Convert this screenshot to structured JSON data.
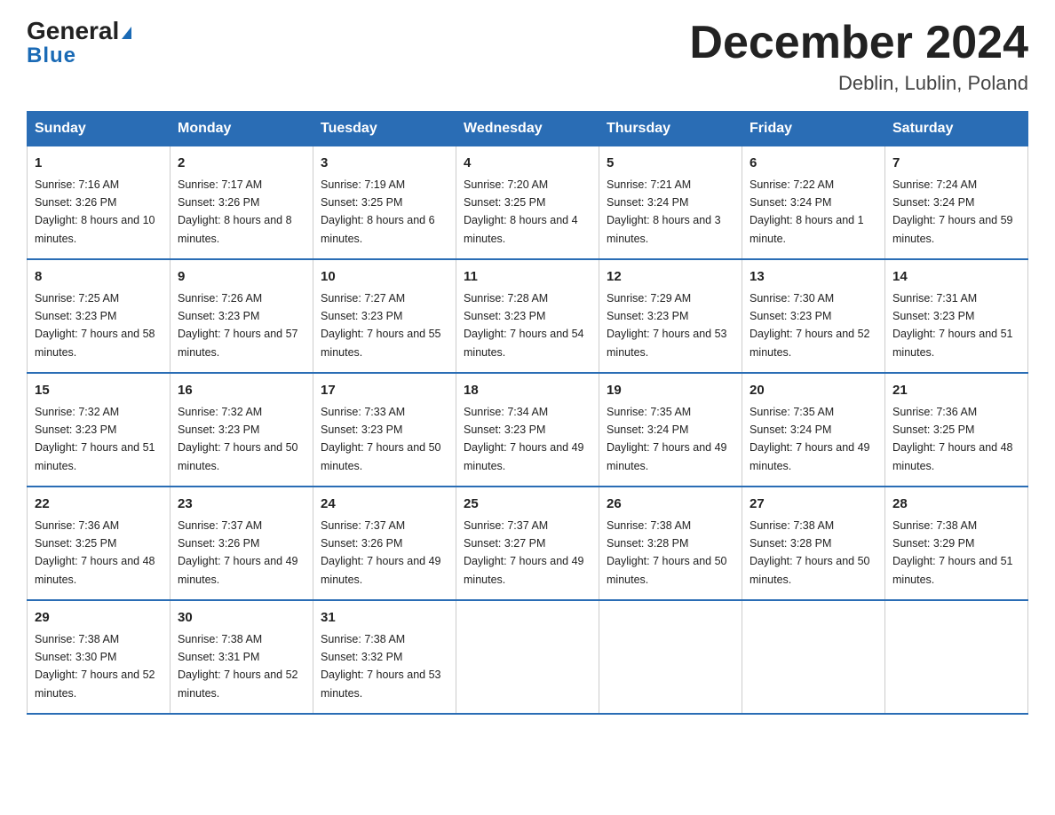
{
  "header": {
    "logo_general": "General",
    "logo_blue": "Blue",
    "title": "December 2024",
    "subtitle": "Deblin, Lublin, Poland"
  },
  "days_of_week": [
    "Sunday",
    "Monday",
    "Tuesday",
    "Wednesday",
    "Thursday",
    "Friday",
    "Saturday"
  ],
  "weeks": [
    [
      {
        "day": "1",
        "sunrise": "7:16 AM",
        "sunset": "3:26 PM",
        "daylight": "8 hours and 10 minutes."
      },
      {
        "day": "2",
        "sunrise": "7:17 AM",
        "sunset": "3:26 PM",
        "daylight": "8 hours and 8 minutes."
      },
      {
        "day": "3",
        "sunrise": "7:19 AM",
        "sunset": "3:25 PM",
        "daylight": "8 hours and 6 minutes."
      },
      {
        "day": "4",
        "sunrise": "7:20 AM",
        "sunset": "3:25 PM",
        "daylight": "8 hours and 4 minutes."
      },
      {
        "day": "5",
        "sunrise": "7:21 AM",
        "sunset": "3:24 PM",
        "daylight": "8 hours and 3 minutes."
      },
      {
        "day": "6",
        "sunrise": "7:22 AM",
        "sunset": "3:24 PM",
        "daylight": "8 hours and 1 minute."
      },
      {
        "day": "7",
        "sunrise": "7:24 AM",
        "sunset": "3:24 PM",
        "daylight": "7 hours and 59 minutes."
      }
    ],
    [
      {
        "day": "8",
        "sunrise": "7:25 AM",
        "sunset": "3:23 PM",
        "daylight": "7 hours and 58 minutes."
      },
      {
        "day": "9",
        "sunrise": "7:26 AM",
        "sunset": "3:23 PM",
        "daylight": "7 hours and 57 minutes."
      },
      {
        "day": "10",
        "sunrise": "7:27 AM",
        "sunset": "3:23 PM",
        "daylight": "7 hours and 55 minutes."
      },
      {
        "day": "11",
        "sunrise": "7:28 AM",
        "sunset": "3:23 PM",
        "daylight": "7 hours and 54 minutes."
      },
      {
        "day": "12",
        "sunrise": "7:29 AM",
        "sunset": "3:23 PM",
        "daylight": "7 hours and 53 minutes."
      },
      {
        "day": "13",
        "sunrise": "7:30 AM",
        "sunset": "3:23 PM",
        "daylight": "7 hours and 52 minutes."
      },
      {
        "day": "14",
        "sunrise": "7:31 AM",
        "sunset": "3:23 PM",
        "daylight": "7 hours and 51 minutes."
      }
    ],
    [
      {
        "day": "15",
        "sunrise": "7:32 AM",
        "sunset": "3:23 PM",
        "daylight": "7 hours and 51 minutes."
      },
      {
        "day": "16",
        "sunrise": "7:32 AM",
        "sunset": "3:23 PM",
        "daylight": "7 hours and 50 minutes."
      },
      {
        "day": "17",
        "sunrise": "7:33 AM",
        "sunset": "3:23 PM",
        "daylight": "7 hours and 50 minutes."
      },
      {
        "day": "18",
        "sunrise": "7:34 AM",
        "sunset": "3:23 PM",
        "daylight": "7 hours and 49 minutes."
      },
      {
        "day": "19",
        "sunrise": "7:35 AM",
        "sunset": "3:24 PM",
        "daylight": "7 hours and 49 minutes."
      },
      {
        "day": "20",
        "sunrise": "7:35 AM",
        "sunset": "3:24 PM",
        "daylight": "7 hours and 49 minutes."
      },
      {
        "day": "21",
        "sunrise": "7:36 AM",
        "sunset": "3:25 PM",
        "daylight": "7 hours and 48 minutes."
      }
    ],
    [
      {
        "day": "22",
        "sunrise": "7:36 AM",
        "sunset": "3:25 PM",
        "daylight": "7 hours and 48 minutes."
      },
      {
        "day": "23",
        "sunrise": "7:37 AM",
        "sunset": "3:26 PM",
        "daylight": "7 hours and 49 minutes."
      },
      {
        "day": "24",
        "sunrise": "7:37 AM",
        "sunset": "3:26 PM",
        "daylight": "7 hours and 49 minutes."
      },
      {
        "day": "25",
        "sunrise": "7:37 AM",
        "sunset": "3:27 PM",
        "daylight": "7 hours and 49 minutes."
      },
      {
        "day": "26",
        "sunrise": "7:38 AM",
        "sunset": "3:28 PM",
        "daylight": "7 hours and 50 minutes."
      },
      {
        "day": "27",
        "sunrise": "7:38 AM",
        "sunset": "3:28 PM",
        "daylight": "7 hours and 50 minutes."
      },
      {
        "day": "28",
        "sunrise": "7:38 AM",
        "sunset": "3:29 PM",
        "daylight": "7 hours and 51 minutes."
      }
    ],
    [
      {
        "day": "29",
        "sunrise": "7:38 AM",
        "sunset": "3:30 PM",
        "daylight": "7 hours and 52 minutes."
      },
      {
        "day": "30",
        "sunrise": "7:38 AM",
        "sunset": "3:31 PM",
        "daylight": "7 hours and 52 minutes."
      },
      {
        "day": "31",
        "sunrise": "7:38 AM",
        "sunset": "3:32 PM",
        "daylight": "7 hours and 53 minutes."
      },
      null,
      null,
      null,
      null
    ]
  ],
  "labels": {
    "sunrise": "Sunrise:",
    "sunset": "Sunset:",
    "daylight": "Daylight:"
  }
}
